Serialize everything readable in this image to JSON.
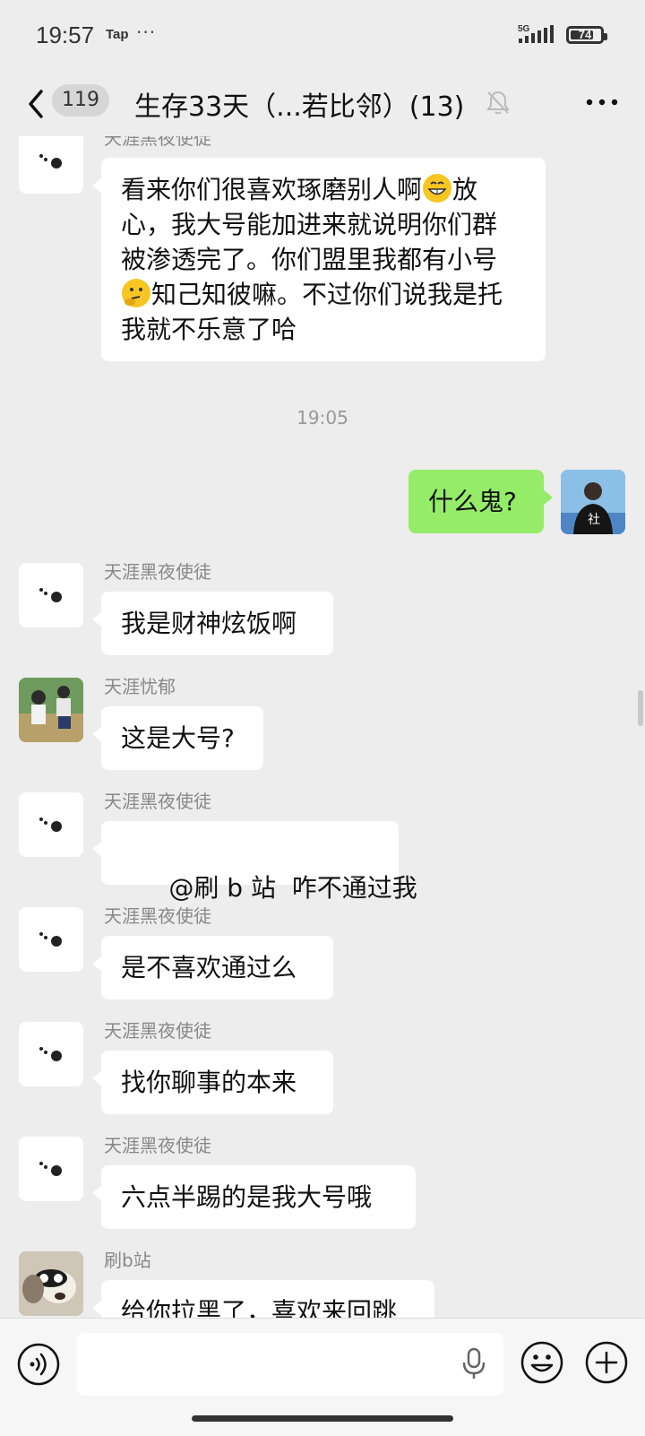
{
  "status_bar": {
    "time": "19:57",
    "app_label": "Tap",
    "more": "···",
    "network": "5G",
    "battery": "74"
  },
  "header": {
    "unread_count": "119",
    "title": "生存33天（...若比邻）(13)"
  },
  "messages": [
    {
      "type": "incoming",
      "sender": "天涯黑夜使徒",
      "lines": [
        "看来你们很喜欢琢磨别人啊",
        "放",
        "心，我大号能加进来就说明你们群",
        "被渗透完了。你们盟里我都有小号",
        "知己知彼嘛。不过你们说我是托",
        "我就不乐意了哈"
      ]
    },
    {
      "type": "timestamp",
      "text": "19:05"
    },
    {
      "type": "outgoing",
      "text": "什么鬼?"
    },
    {
      "type": "incoming",
      "sender": "天涯黑夜使徒",
      "text": "我是财神炫饭啊"
    },
    {
      "type": "incoming",
      "sender": "天涯忧郁",
      "text": "这是大号?"
    },
    {
      "type": "incoming",
      "sender": "天涯黑夜使徒",
      "text": "@刷 b 站  咋不通过我"
    },
    {
      "type": "incoming",
      "sender": "天涯黑夜使徒",
      "text": "是不喜欢通过么"
    },
    {
      "type": "incoming",
      "sender": "天涯黑夜使徒",
      "text": "找你聊事的本来"
    },
    {
      "type": "incoming",
      "sender": "天涯黑夜使徒",
      "text": "六点半踢的是我大号哦"
    },
    {
      "type": "incoming",
      "sender": "刷b站",
      "text": "给你拉黑了，喜欢来回跳"
    }
  ],
  "icons": {
    "back": "chevron-left-icon",
    "mute": "bell-off-icon",
    "more": "more-horizontal-icon",
    "voice": "voice-icon",
    "mic": "microphone-icon",
    "emoji": "emoji-icon",
    "plus": "plus-icon"
  },
  "colors": {
    "background": "#ededed",
    "outgoing_bubble": "#95ec69",
    "incoming_bubble": "#ffffff",
    "muted_text": "#888888"
  }
}
